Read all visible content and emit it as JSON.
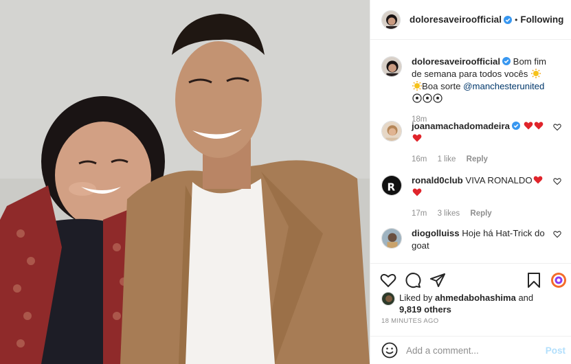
{
  "header": {
    "username": "doloresaveiroofficial",
    "separator": "•",
    "follow_state": "Following"
  },
  "caption": {
    "username": "doloresaveiroofficial",
    "text": "Bom fim de semana para todos vocês",
    "text2": "Boa sorte",
    "mention": "@manchesterunited",
    "time": "18m"
  },
  "comments": [
    {
      "username": "joanamachadomadeira",
      "text": "",
      "time": "16m",
      "likes": "1 like",
      "reply": "Reply"
    },
    {
      "username": "ronald0club",
      "text": "VIVA RONALDO",
      "time": "17m",
      "likes": "3 likes",
      "reply": "Reply"
    },
    {
      "username": "diogolluiss",
      "text": "Hoje há Hat-Trick do goat"
    }
  ],
  "likes": {
    "prefix": "Liked by",
    "user": "ahmedabohashima",
    "mid": "and",
    "others": "9,819 others"
  },
  "timestamp": "18 MINUTES AGO",
  "add_comment": {
    "placeholder": "Add a comment...",
    "post_label": "Post"
  },
  "icons": [
    "heart-icon",
    "comment-icon",
    "share-icon",
    "bookmark-icon",
    "emoji-icon",
    "verified-icon"
  ],
  "colors": {
    "link": "#00376b",
    "meta": "#8e8e8e",
    "verified": "#3897f0",
    "heart": "#e0242b",
    "post_disabled": "#b2dffc"
  }
}
